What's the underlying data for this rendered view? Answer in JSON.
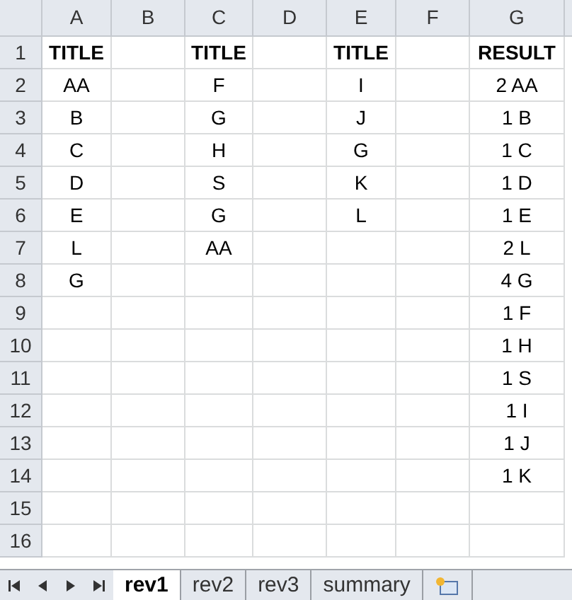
{
  "columns": [
    "A",
    "B",
    "C",
    "D",
    "E",
    "F",
    "G"
  ],
  "title_row": {
    "number": "1",
    "cells": {
      "A": "TITLE",
      "C": "TITLE",
      "E": "TITLE",
      "G": "RESULT"
    }
  },
  "rows": [
    {
      "number": "2",
      "cells": {
        "A": "AA",
        "C": "F",
        "E": "I",
        "G": "2 AA"
      }
    },
    {
      "number": "3",
      "cells": {
        "A": "B",
        "C": "G",
        "E": "J",
        "G": "1 B"
      }
    },
    {
      "number": "4",
      "cells": {
        "A": "C",
        "C": "H",
        "E": "G",
        "G": "1 C"
      }
    },
    {
      "number": "5",
      "cells": {
        "A": "D",
        "C": "S",
        "E": "K",
        "G": "1 D"
      }
    },
    {
      "number": "6",
      "cells": {
        "A": "E",
        "C": "G",
        "E": "L",
        "G": "1 E"
      }
    },
    {
      "number": "7",
      "cells": {
        "A": "L",
        "C": "AA",
        "G": "2 L"
      }
    },
    {
      "number": "8",
      "cells": {
        "A": "G",
        "G": "4 G"
      }
    },
    {
      "number": "9",
      "cells": {
        "G": "1 F"
      }
    },
    {
      "number": "10",
      "cells": {
        "G": "1 H"
      }
    },
    {
      "number": "11",
      "cells": {
        "G": "1 S"
      }
    },
    {
      "number": "12",
      "cells": {
        "G": "1 I"
      }
    },
    {
      "number": "13",
      "cells": {
        "G": "1 J"
      }
    },
    {
      "number": "14",
      "cells": {
        "G": "1 K"
      }
    },
    {
      "number": "15",
      "cells": {}
    },
    {
      "number": "16",
      "cells": {}
    }
  ],
  "sheet_tabs": [
    {
      "label": "rev1",
      "selected": true
    },
    {
      "label": "rev2",
      "selected": false
    },
    {
      "label": "rev3",
      "selected": false
    },
    {
      "label": "summary",
      "selected": false
    }
  ]
}
